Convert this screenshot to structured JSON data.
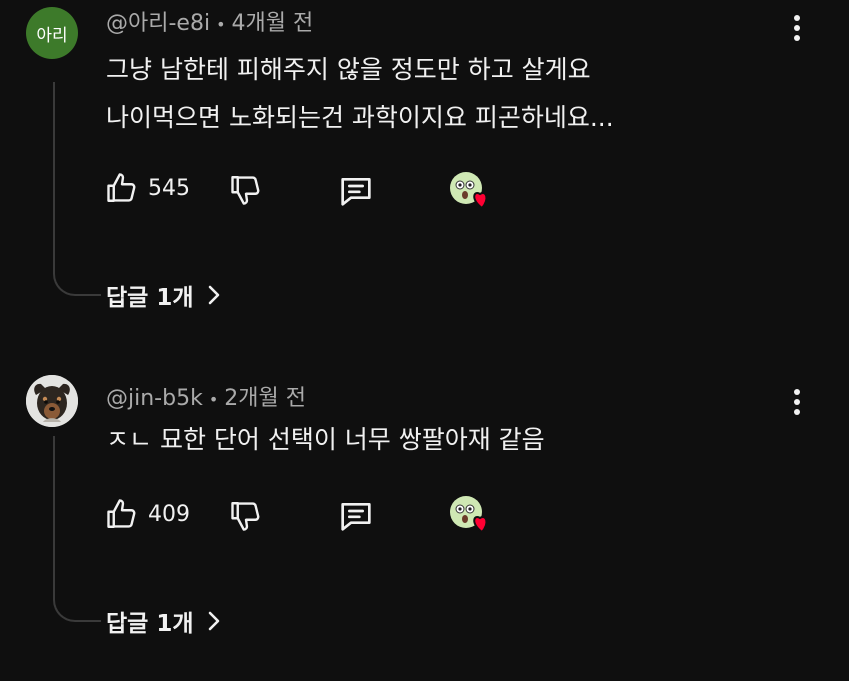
{
  "comments": [
    {
      "avatar_text": "아리",
      "author": "@아리-e8i",
      "separator": "•",
      "time": "4개월 전",
      "lines": [
        "그냥 남한테 피해주지 않을 정도만 하고 살게요",
        "나이먹으면 노화되는건 과학이지요 피곤하네요..."
      ],
      "likes": "545",
      "replies_label": "답글 1개"
    },
    {
      "author": "@jin-b5k",
      "separator": "•",
      "time": "2개월 전",
      "lines": [
        "ㅈㄴ 묘한 단어 선택이 너무 쌍팔아재 같음"
      ],
      "likes": "409",
      "replies_label": "답글 1개"
    }
  ],
  "icons": {
    "like": "thumbs-up-icon",
    "dislike": "thumbs-down-icon",
    "reply": "reply-comment-icon",
    "creator_heart": "creator-heart-avatar-icon",
    "more": "more-vert-icon",
    "expand": "chevron-right-icon"
  },
  "colors": {
    "background": "#0f0f0f",
    "text": "#f1f1f1",
    "meta": "#aaaaaa",
    "heart": "#ff0033",
    "avatar_green": "#3d7a2a"
  }
}
